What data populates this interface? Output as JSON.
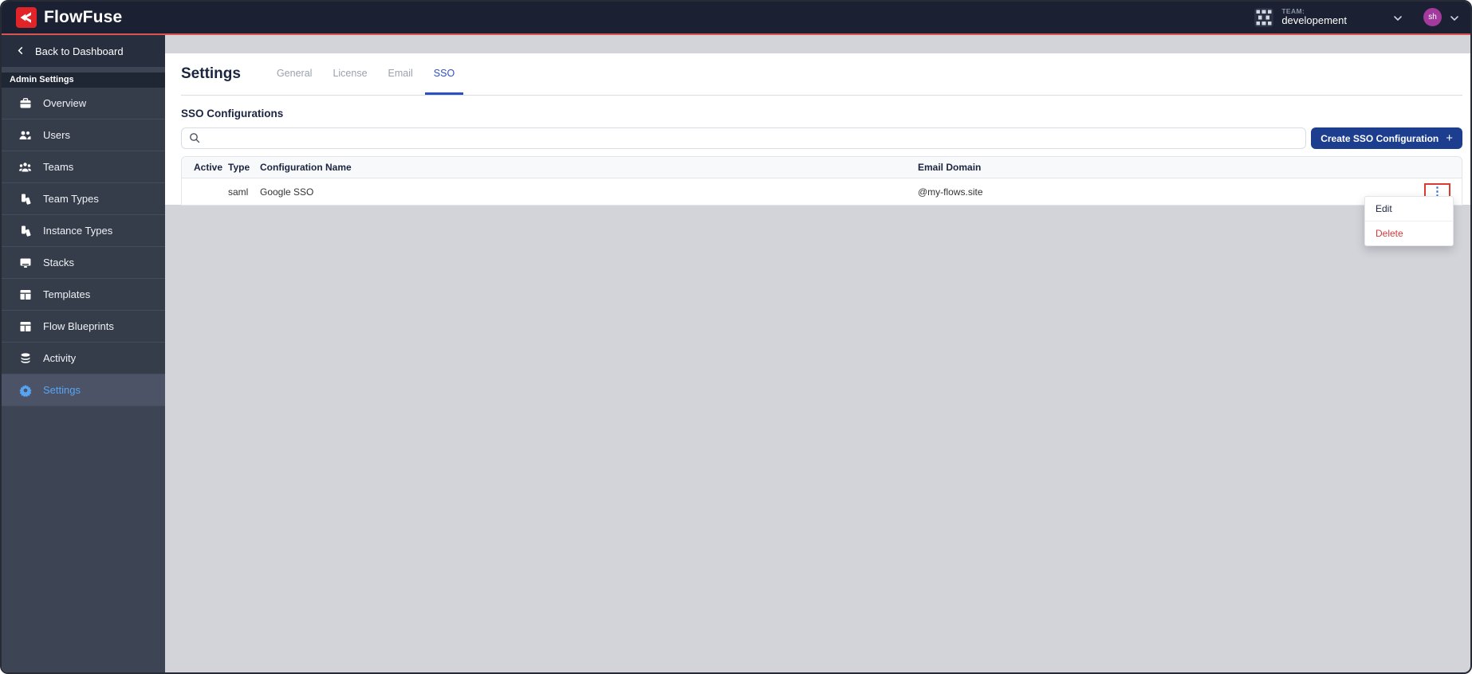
{
  "navbar": {
    "brand": "FlowFuse",
    "team_label": "TEAM:",
    "team_name": "developement",
    "avatar_initials": "sh"
  },
  "sidebar": {
    "back_label": "Back to Dashboard",
    "section_label": "Admin Settings",
    "items": [
      {
        "label": "Overview",
        "icon": "briefcase-icon"
      },
      {
        "label": "Users",
        "icon": "users-icon"
      },
      {
        "label": "Teams",
        "icon": "teams-icon"
      },
      {
        "label": "Team Types",
        "icon": "badges-icon"
      },
      {
        "label": "Instance Types",
        "icon": "badges-icon"
      },
      {
        "label": "Stacks",
        "icon": "monitor-icon"
      },
      {
        "label": "Templates",
        "icon": "template-icon"
      },
      {
        "label": "Flow Blueprints",
        "icon": "template-icon"
      },
      {
        "label": "Activity",
        "icon": "database-icon"
      },
      {
        "label": "Settings",
        "icon": "gear-icon",
        "active": true
      }
    ]
  },
  "main": {
    "title": "Settings",
    "tabs": [
      {
        "label": "General"
      },
      {
        "label": "License"
      },
      {
        "label": "Email"
      },
      {
        "label": "SSO",
        "active": true
      }
    ],
    "section_title": "SSO Configurations",
    "search_placeholder": "",
    "create_button_label": "Create SSO Configuration",
    "create_button_plus": "+",
    "table": {
      "headers": [
        "Active",
        "Type",
        "Configuration Name",
        "Email Domain"
      ],
      "rows": [
        {
          "active": "",
          "type": "saml",
          "name": "Google SSO",
          "email_domain": "@my-flows.site"
        }
      ]
    },
    "row_menu": {
      "edit_label": "Edit",
      "delete_label": "Delete"
    },
    "kebab_glyph": "⋮"
  },
  "colors": {
    "brand_red": "#e02428",
    "navbar_bg": "#1b2132",
    "navbar_underline": "#d9534f",
    "sidebar_bg": "#3d4454",
    "sidebar_active_text": "#57a5f2",
    "tab_active_blue": "#2d4fc4",
    "link_blue": "#3e7ce0",
    "button_bg": "#1d3e8e",
    "danger_red": "#d23b3b",
    "annotation_red": "#dd3a30",
    "avatar_purple": "#a43a9d"
  }
}
